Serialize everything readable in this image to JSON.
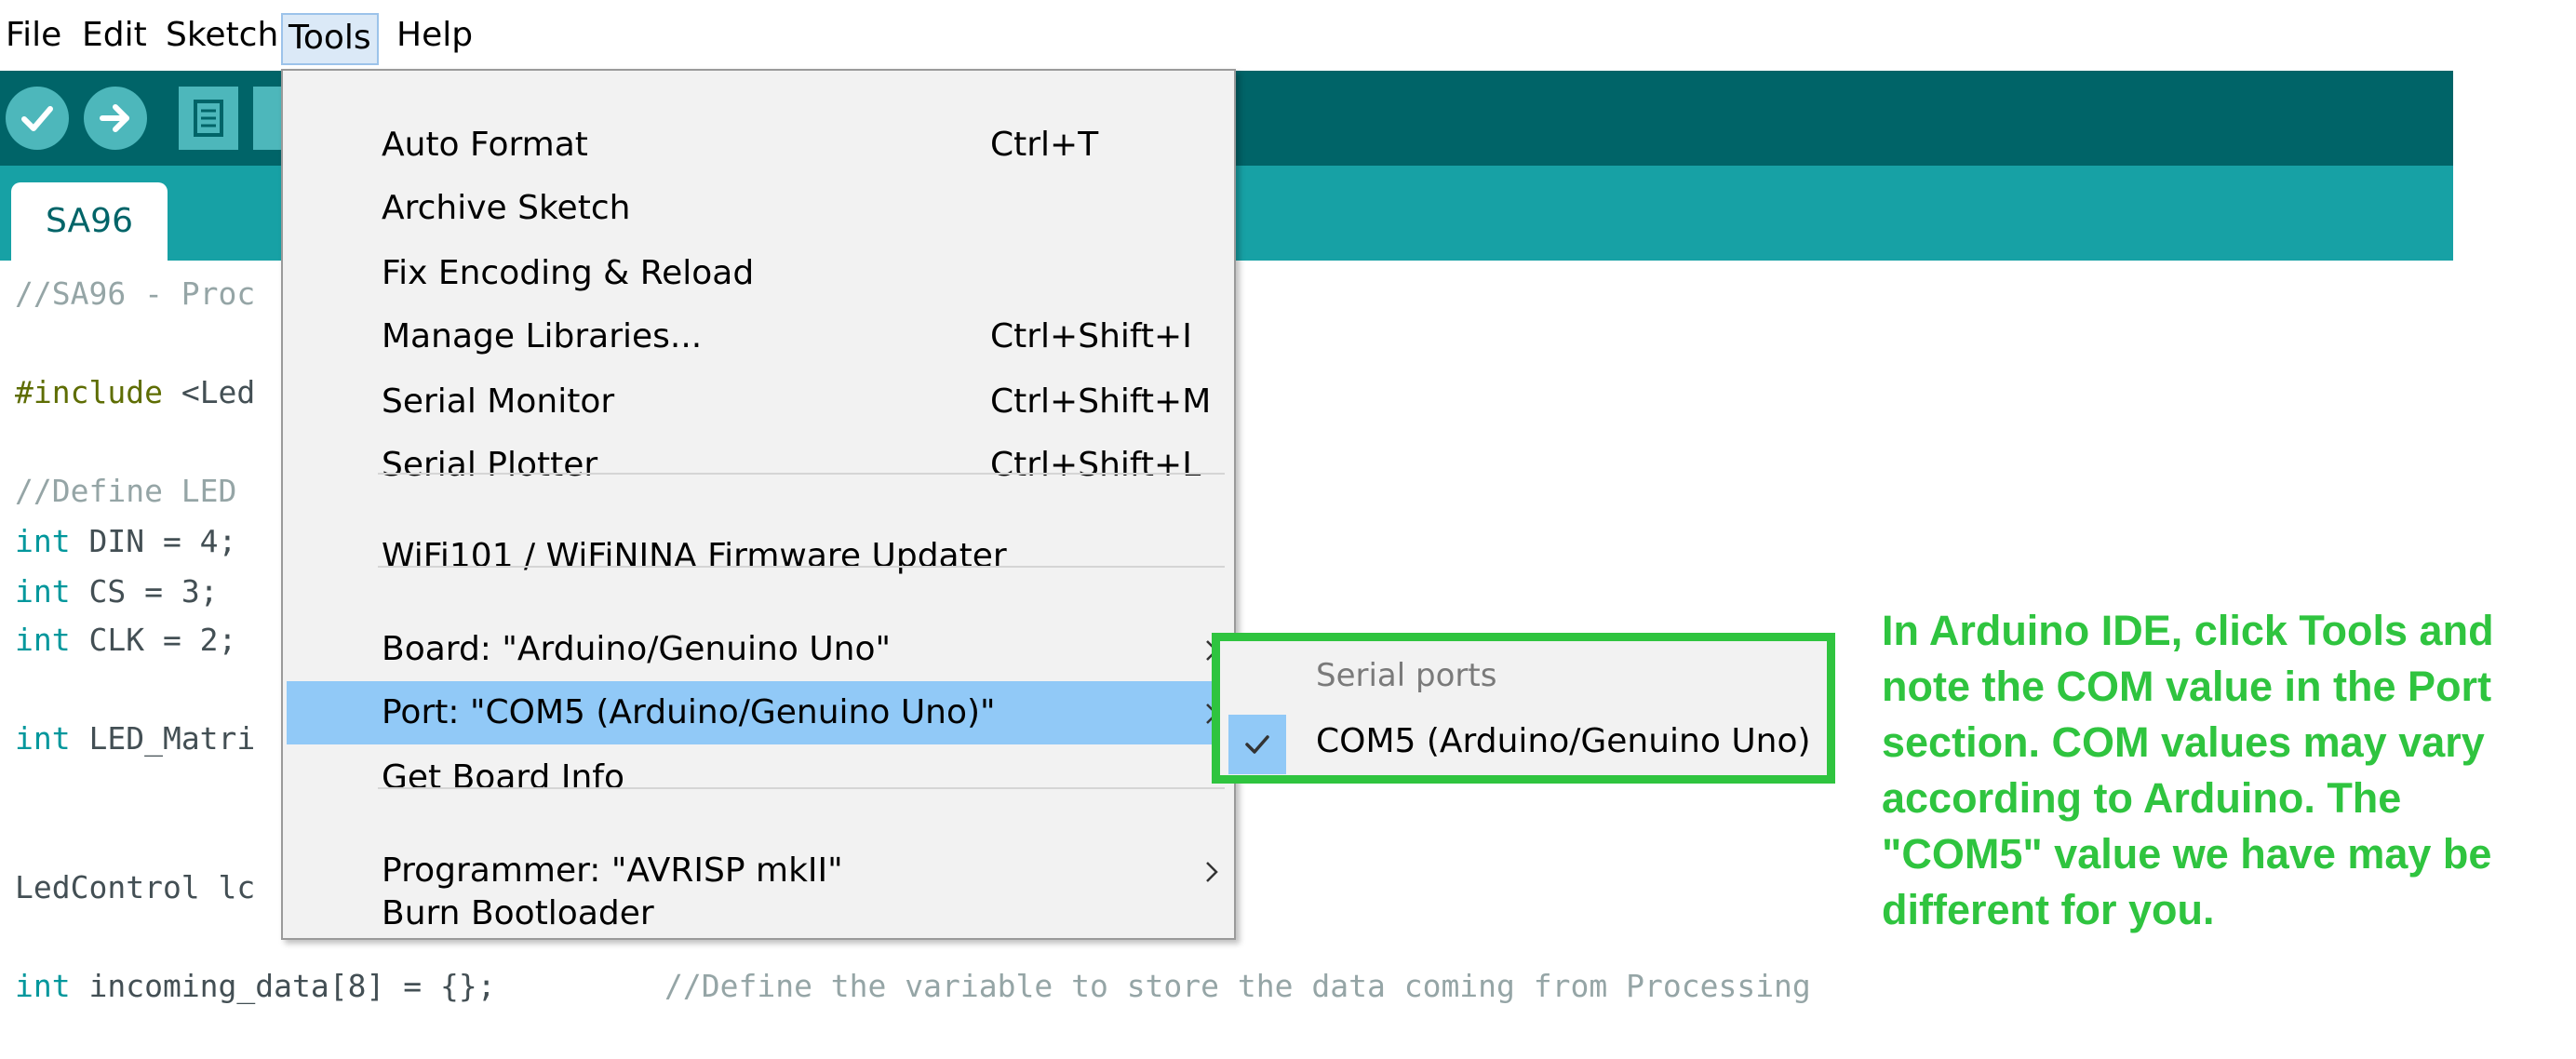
{
  "menubar": {
    "items": [
      "File",
      "Edit",
      "Sketch",
      "Tools",
      "Help"
    ],
    "active": "Tools"
  },
  "tab": {
    "label": "SA96"
  },
  "code": {
    "line1": "//SA96 - Proc",
    "line2_directive": "#include",
    "line2_rest": " <Led",
    "line3": "//Define LED",
    "line4_kw": "int",
    "line4_rest": " DIN = 4;",
    "line5_kw": "int",
    "line5_rest": " CS = 3;",
    "line6_kw": "int",
    "line6_rest": " CLK = 2;",
    "line7_kw": "int",
    "line7_rest": " LED_Matri",
    "line8": "LedControl lc",
    "line9_kw": "int",
    "line9_rest": " incoming_data[8] = {};",
    "line9_comment": "//Define the variable to store the data coming from Processing"
  },
  "tools_menu": {
    "items": [
      {
        "label": "Auto Format",
        "shortcut": "Ctrl+T"
      },
      {
        "label": "Archive Sketch",
        "shortcut": ""
      },
      {
        "label": "Fix Encoding & Reload",
        "shortcut": ""
      },
      {
        "label": "Manage Libraries...",
        "shortcut": "Ctrl+Shift+I"
      },
      {
        "label": "Serial Monitor",
        "shortcut": "Ctrl+Shift+M"
      },
      {
        "label": "Serial Plotter",
        "shortcut": "Ctrl+Shift+L"
      },
      {
        "label": "WiFi101 / WiFiNINA Firmware Updater",
        "shortcut": ""
      },
      {
        "label": "Board: \"Arduino/Genuino Uno\"",
        "shortcut": ""
      },
      {
        "label": "Port: \"COM5 (Arduino/Genuino Uno)\"",
        "shortcut": ""
      },
      {
        "label": "Get Board Info",
        "shortcut": ""
      },
      {
        "label": "Programmer: \"AVRISP mkII\"",
        "shortcut": ""
      },
      {
        "label": "Burn Bootloader",
        "shortcut": ""
      }
    ]
  },
  "port_submenu": {
    "header": "Serial ports",
    "item": "COM5 (Arduino/Genuino Uno)"
  },
  "annotation": {
    "lines": [
      "In Arduino IDE, click Tools and",
      "note the COM value in the Port",
      "section. COM values may vary",
      "according to Arduino. The",
      "\"COM5\" value we have may be",
      "different for you."
    ],
    "color": "#2fc43f"
  },
  "colors": {
    "toolbar": "#006468",
    "tabbar": "#17a1a5",
    "menu_highlight": "#91c9f7"
  },
  "icons": [
    "verify-icon",
    "upload-icon",
    "new-sketch-icon",
    "submenu-arrow-icon",
    "checkmark-icon"
  ]
}
